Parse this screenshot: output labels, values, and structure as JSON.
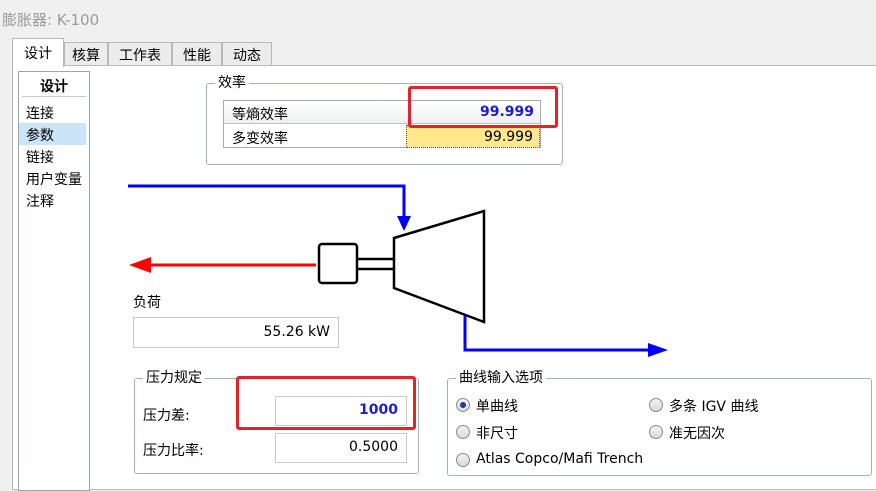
{
  "window": {
    "title": "膨胀器: K-100"
  },
  "tabs": [
    {
      "label": "设计",
      "active": true
    },
    {
      "label": "核算",
      "active": false
    },
    {
      "label": "工作表",
      "active": false
    },
    {
      "label": "性能",
      "active": false
    },
    {
      "label": "动态",
      "active": false
    }
  ],
  "nav": {
    "header": "设计",
    "items": [
      {
        "label": "连接",
        "selected": false
      },
      {
        "label": "参数",
        "selected": true
      },
      {
        "label": "链接",
        "selected": false
      },
      {
        "label": "用户变量",
        "selected": false
      },
      {
        "label": "注释",
        "selected": false
      }
    ]
  },
  "efficiency": {
    "title": "效率",
    "rows": [
      {
        "label": "等熵效率",
        "value": "99.999",
        "value_color": "#1c1cd0"
      },
      {
        "label": "多变效率",
        "value": "99.999",
        "value_color": "#000000"
      }
    ]
  },
  "load": {
    "label": "负荷",
    "value": "55.26 kW"
  },
  "pressure": {
    "title": "压力规定",
    "delta_label": "压力差:",
    "delta_value": "1000",
    "ratio_label": "压力比率:",
    "ratio_value": "0.5000"
  },
  "curve": {
    "title": "曲线输入选项",
    "options": [
      {
        "label": "单曲线",
        "checked": true
      },
      {
        "label": "多条 IGV 曲线",
        "checked": false
      },
      {
        "label": "非尺寸",
        "checked": false
      },
      {
        "label": "准无因次",
        "checked": false
      },
      {
        "label": "Atlas Copco/Mafi Trench",
        "checked": false
      }
    ]
  },
  "colors": {
    "material_stream": "#0000ff",
    "energy_stream": "#ff0000",
    "highlight": "#e0242c",
    "calculated_cell": "#ffe88c",
    "specified_value": "#1c1cd0"
  }
}
